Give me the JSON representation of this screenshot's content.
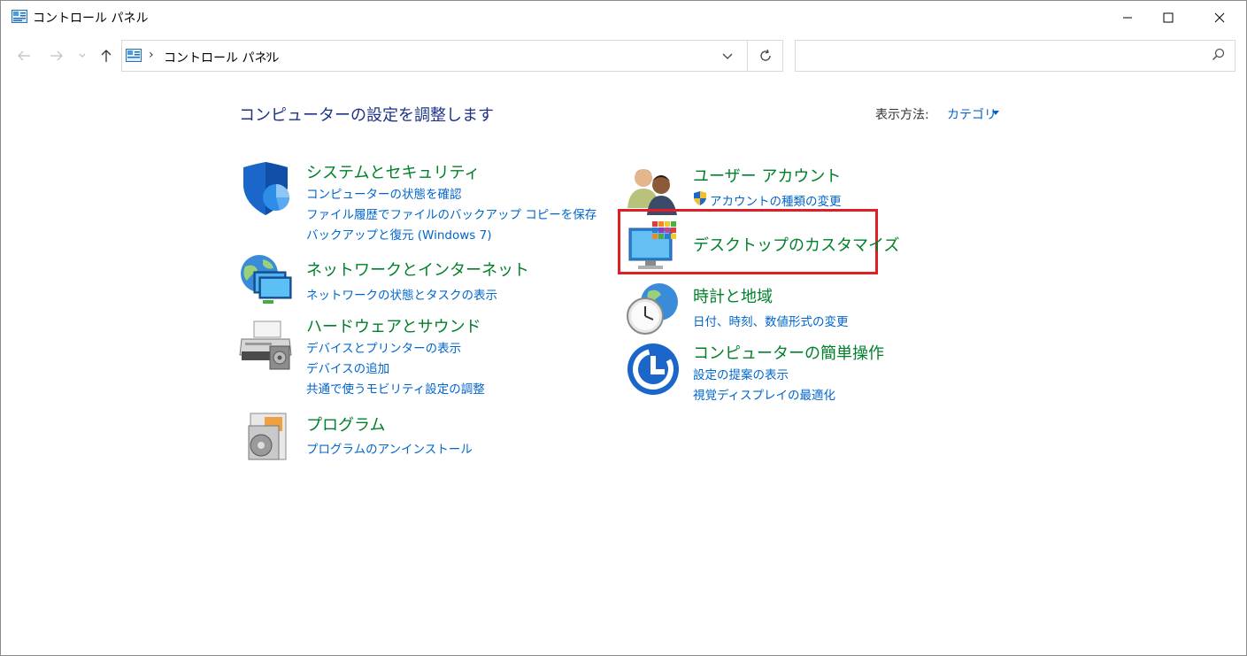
{
  "window": {
    "title": "コントロール パネル",
    "controls": {
      "minimize_icon": "minimize-icon",
      "maximize_icon": "maximize-icon",
      "close_icon": "close-icon"
    }
  },
  "nav": {
    "breadcrumb": "コントロール パネル",
    "search_placeholder": ""
  },
  "main": {
    "heading": "コンピューターの設定を調整します",
    "view_by_label": "表示方法:",
    "view_by_value": "カテゴリ"
  },
  "categories": {
    "system_security": {
      "title": "システムとセキュリティ",
      "links": [
        "コンピューターの状態を確認",
        "ファイル履歴でファイルのバックアップ コピーを保存",
        "バックアップと復元 (Windows 7)"
      ]
    },
    "network": {
      "title": "ネットワークとインターネット",
      "links": [
        "ネットワークの状態とタスクの表示"
      ]
    },
    "hardware": {
      "title": "ハードウェアとサウンド",
      "links": [
        "デバイスとプリンターの表示",
        "デバイスの追加",
        "共通で使うモビリティ設定の調整"
      ]
    },
    "programs": {
      "title": "プログラム",
      "links": [
        "プログラムのアンインストール"
      ]
    },
    "user_accounts": {
      "title": "ユーザー アカウント",
      "links": [
        "アカウントの種類の変更"
      ]
    },
    "appearance": {
      "title": "デスクトップのカスタマイズ",
      "links": []
    },
    "clock_region": {
      "title": "時計と地域",
      "links": [
        "日付、時刻、数値形式の変更"
      ]
    },
    "ease_of_access": {
      "title": "コンピューターの簡単操作",
      "links": [
        "設定の提案の表示",
        "視覚ディスプレイの最適化"
      ]
    }
  },
  "colors": {
    "heading": "#1e3287",
    "category_title": "#00802a",
    "link": "#0066cc",
    "highlight": "#e01e26"
  }
}
